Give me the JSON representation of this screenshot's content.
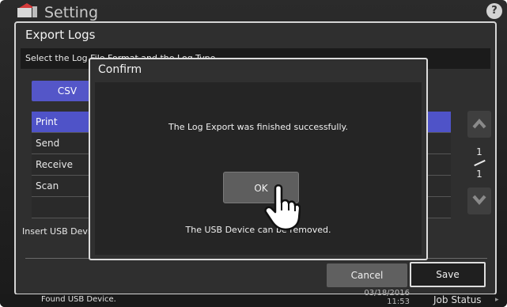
{
  "app": {
    "title": "Setting",
    "help_label": "?"
  },
  "panel": {
    "title": "Export Logs",
    "instruction": "Select the Log File Format and the Log Type.",
    "format_button": "CSV",
    "log_types": [
      {
        "label": "Print",
        "selected": true
      },
      {
        "label": "Send",
        "selected": false
      },
      {
        "label": "Receive",
        "selected": false
      },
      {
        "label": "Scan",
        "selected": false
      },
      {
        "label": "",
        "selected": false
      }
    ],
    "page": {
      "current": "1",
      "total": "1"
    },
    "insert_usb_text": "Insert USB Device",
    "cancel_label": "Cancel",
    "save_label": "Save"
  },
  "dialog": {
    "title": "Confirm",
    "message": "The Log Export was finished successfully.",
    "ok_label": "OK",
    "usb_message": "The USB Device can be removed."
  },
  "statusbar": {
    "message": "Found USB Device.",
    "date": "03/18/2016",
    "time": "11:53",
    "job_status": "Job Status"
  },
  "colors": {
    "accent": "#5456c8",
    "selected_row": "#4f53c8",
    "background": "#2f2f2f"
  }
}
